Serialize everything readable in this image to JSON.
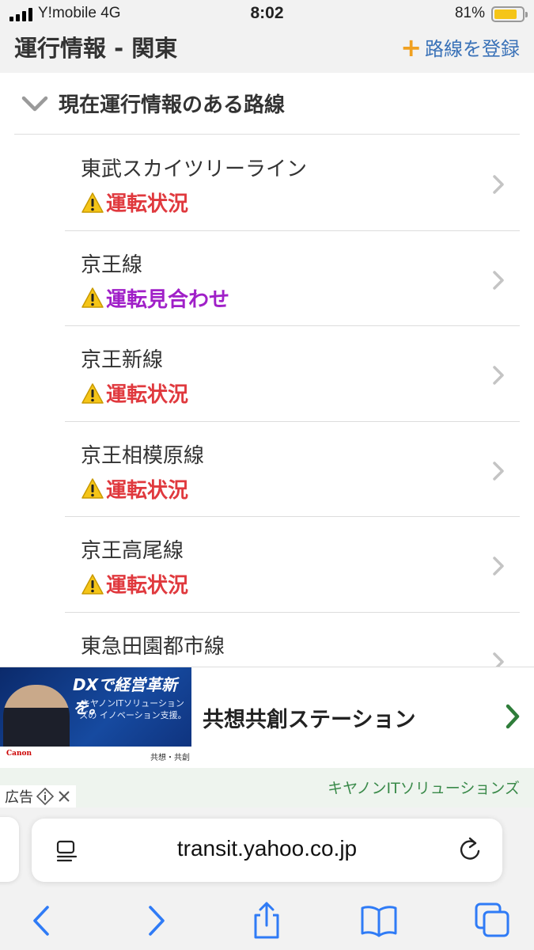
{
  "status_bar": {
    "carrier": "Y!mobile   4G",
    "time": "8:02",
    "battery": "81%"
  },
  "header": {
    "title": "運行情報 - 関東",
    "register_label": "路線を登録"
  },
  "section": {
    "title": "現在運行情報のある路線"
  },
  "lines": [
    {
      "name": "東武スカイツリーライン",
      "status": "運転状況",
      "status_color": "#e0393e"
    },
    {
      "name": "京王線",
      "status": "運転見合わせ",
      "status_color": "#a020c8"
    },
    {
      "name": "京王新線",
      "status": "運転状況",
      "status_color": "#e0393e"
    },
    {
      "name": "京王相模原線",
      "status": "運転状況",
      "status_color": "#e0393e"
    },
    {
      "name": "京王高尾線",
      "status": "運転状況",
      "status_color": "#e0393e"
    },
    {
      "name": "東急田園都市線",
      "status": "",
      "status_color": "#e0393e"
    }
  ],
  "ad": {
    "headline": "DXで経営革新を。",
    "subtext": "キヤノンITソリューションズの イノベーション支援。",
    "logo_text": "Canon",
    "brand_mark": "共想・共創",
    "title": "共想共創ステーション",
    "sponsor": "キヤノンITソリューションズ",
    "label": "広告"
  },
  "browser": {
    "url": "transit.yahoo.co.jp"
  },
  "colors": {
    "accent_blue": "#3a72b8",
    "plus_orange": "#f0a020",
    "warning_red": "#e0393e",
    "warning_purple": "#a020c8",
    "ios_blue": "#2f7bf6"
  }
}
